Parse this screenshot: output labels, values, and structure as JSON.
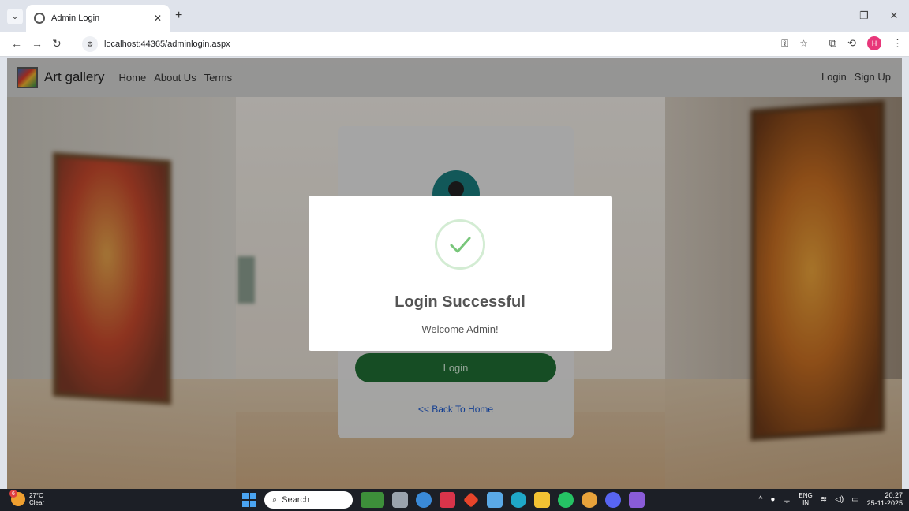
{
  "browser": {
    "tab_title": "Admin Login",
    "new_tab": "+",
    "url": "localhost:44365/adminlogin.aspx",
    "profile_initial": "H"
  },
  "navbar": {
    "brand": "Art gallery",
    "links": [
      "Home",
      "About Us",
      "Terms"
    ],
    "right_links": [
      "Login",
      "Sign Up"
    ]
  },
  "login_card": {
    "button_label": "Login",
    "back_link": "<< Back To Home"
  },
  "modal": {
    "title": "Login Successful",
    "message": "Welcome Admin!",
    "icon": "check-icon"
  },
  "taskbar": {
    "weather_badge": "6",
    "temperature": "27°C",
    "condition": "Clear",
    "search_label": "Search",
    "lang_top": "ENG",
    "lang_bottom": "IN",
    "time": "20:27",
    "date": "25-11-2025"
  },
  "colors": {
    "login_button": "#1f6b32",
    "check": "#78c67a",
    "link": "#1a56c9"
  }
}
